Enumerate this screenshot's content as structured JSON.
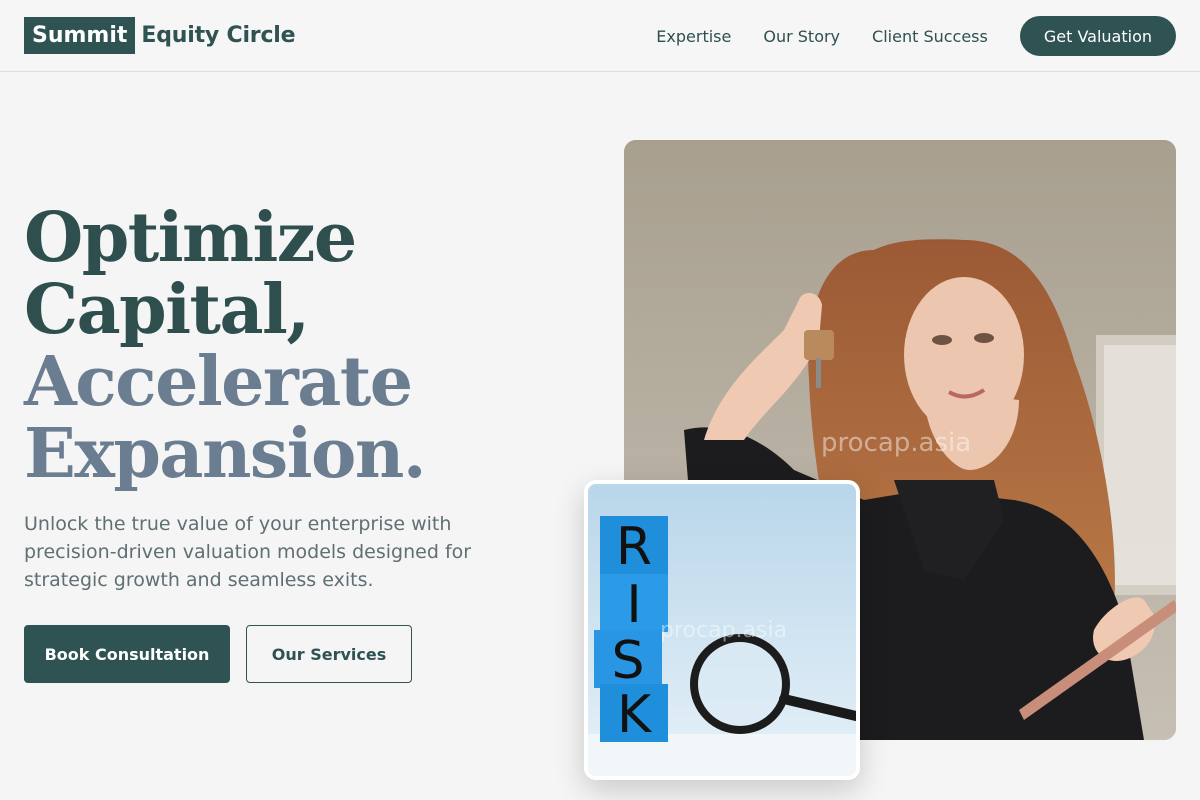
{
  "header": {
    "logo_box": "Summit",
    "logo_text": "Equity Circle",
    "nav": [
      "Expertise",
      "Our Story",
      "Client Success"
    ],
    "cta": "Get Valuation"
  },
  "hero": {
    "title_line1": "Optimize",
    "title_line2": "Capital,",
    "title_line3": "Accelerate",
    "title_line4": "Expansion.",
    "subtitle": "Unlock the true value of your enterprise with precision-driven valuation models designed for strategic growth and seamless exits.",
    "primary_button": "Book Consultation",
    "secondary_button": "Our Services"
  },
  "images": {
    "main_watermark": "procap.asia",
    "inset_watermark": "procap.asia",
    "inset_letters": [
      "R",
      "I",
      "S",
      "K"
    ]
  },
  "colors": {
    "brand": "#2f5252",
    "accent_text": "#6b7d91",
    "background": "#f5f5f5"
  }
}
